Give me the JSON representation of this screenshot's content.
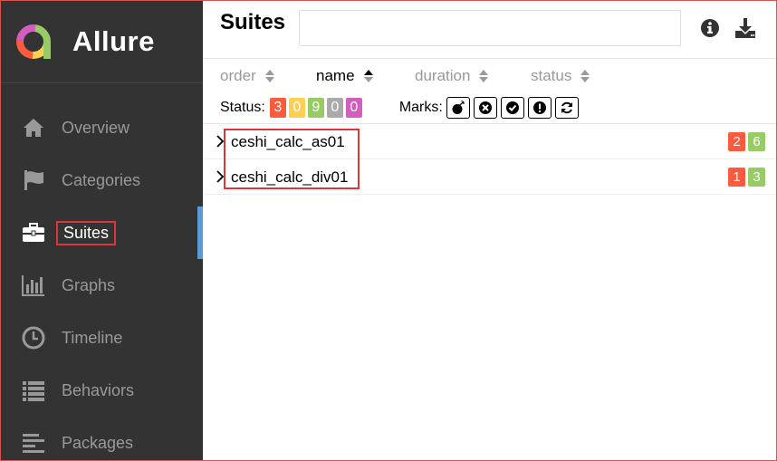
{
  "app": {
    "name": "Allure"
  },
  "sidebar": {
    "items": [
      {
        "label": "Overview",
        "icon": "home-icon"
      },
      {
        "label": "Categories",
        "icon": "flag-icon"
      },
      {
        "label": "Suites",
        "icon": "briefcase-icon",
        "active": true
      },
      {
        "label": "Graphs",
        "icon": "bar-chart-icon"
      },
      {
        "label": "Timeline",
        "icon": "clock-icon"
      },
      {
        "label": "Behaviors",
        "icon": "list-icon"
      },
      {
        "label": "Packages",
        "icon": "align-left-icon"
      }
    ]
  },
  "header": {
    "title": "Suites",
    "search_value": "",
    "info_icon": "info-icon",
    "download_icon": "download-icon"
  },
  "sort": {
    "items": [
      {
        "label": "order"
      },
      {
        "label": "name",
        "active": true
      },
      {
        "label": "duration"
      },
      {
        "label": "status"
      }
    ]
  },
  "filters": {
    "status_label": "Status:",
    "statuses": [
      {
        "count": "3",
        "name": "failed",
        "color": "#fd5a3e"
      },
      {
        "count": "0",
        "name": "broken",
        "color": "#ffd050"
      },
      {
        "count": "9",
        "name": "passed",
        "color": "#97cc64"
      },
      {
        "count": "0",
        "name": "skipped",
        "color": "#aaaaaa"
      },
      {
        "count": "0",
        "name": "unknown",
        "color": "#d35ebe"
      }
    ],
    "marks_label": "Marks:",
    "marks": [
      "bomb-icon",
      "times-circle-icon",
      "check-circle-icon",
      "exclamation-icon",
      "refresh-icon"
    ]
  },
  "suites": [
    {
      "name": "ceshi_calc_as01",
      "failed": "2",
      "passed": "6"
    },
    {
      "name": "ceshi_calc_div01",
      "failed": "1",
      "passed": "3"
    }
  ]
}
